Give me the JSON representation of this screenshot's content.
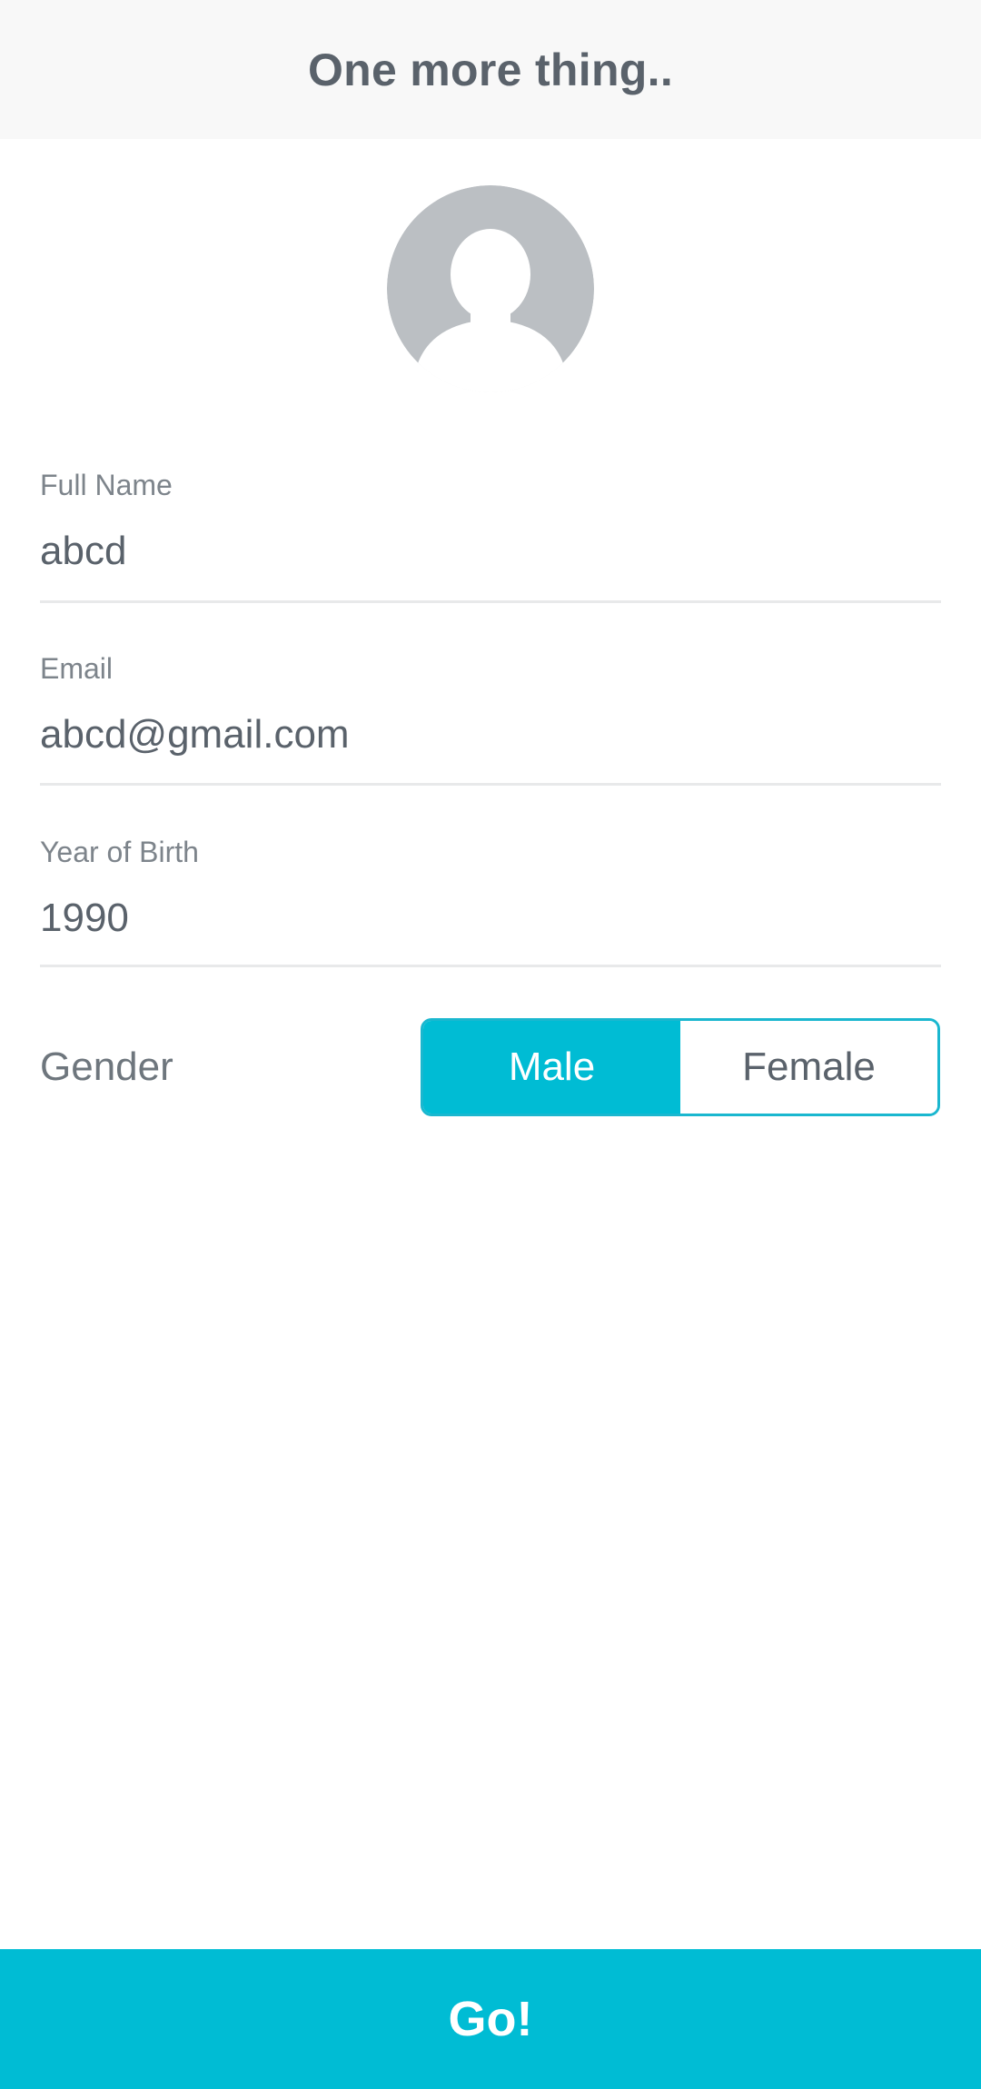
{
  "header": {
    "title": "One more thing.."
  },
  "avatar": {
    "icon": "default-avatar-icon",
    "color": "#bbbfc3"
  },
  "form": {
    "full_name": {
      "label": "Full Name",
      "value": "abcd"
    },
    "email": {
      "label": "Email",
      "value": "abcd@gmail.com"
    },
    "year_of_birth": {
      "label": "Year of Birth",
      "value": "1990"
    },
    "gender": {
      "label": "Gender",
      "options": [
        "Male",
        "Female"
      ],
      "selected": "Male"
    }
  },
  "footer": {
    "go_label": "Go!"
  },
  "colors": {
    "accent": "#00bcd4",
    "text": "#5a626b",
    "header_bg": "#f8f8f8"
  }
}
